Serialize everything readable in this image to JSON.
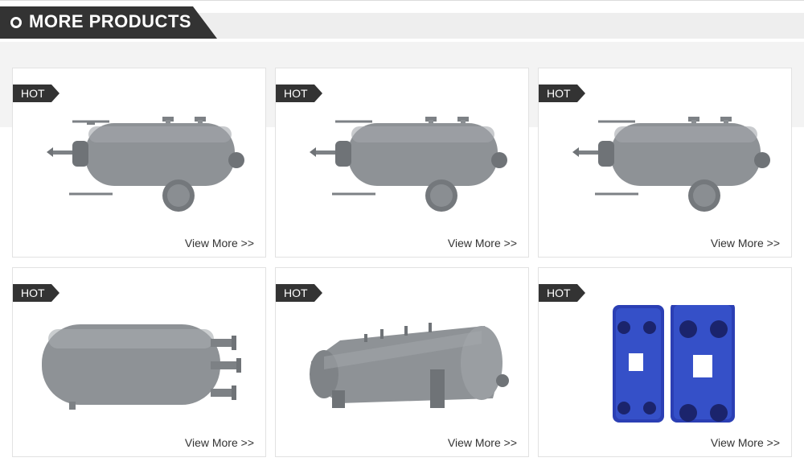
{
  "section": {
    "title": "MORE PRODUCTS"
  },
  "products": [
    {
      "badge": "HOT",
      "image": "horizontal-pressure-vessel-image",
      "link_label": "View More >>"
    },
    {
      "badge": "HOT",
      "image": "horizontal-pressure-vessel-image",
      "link_label": "View More >>"
    },
    {
      "badge": "HOT",
      "image": "horizontal-pressure-vessel-image",
      "link_label": "View More >>"
    },
    {
      "badge": "HOT",
      "image": "horizontal-storage-tank-image",
      "link_label": "View More >>"
    },
    {
      "badge": "HOT",
      "image": "large-horizontal-tank-image",
      "link_label": "View More >>"
    },
    {
      "badge": "HOT",
      "image": "plate-heat-exchanger-image",
      "link_label": "View More >>"
    }
  ],
  "colors": {
    "header_tab": "#333333",
    "header_band": "#eeeeee",
    "badge": "#333333",
    "vessel_gray": "#8e9296",
    "heat_exchanger_blue": "#2b3fb4"
  }
}
